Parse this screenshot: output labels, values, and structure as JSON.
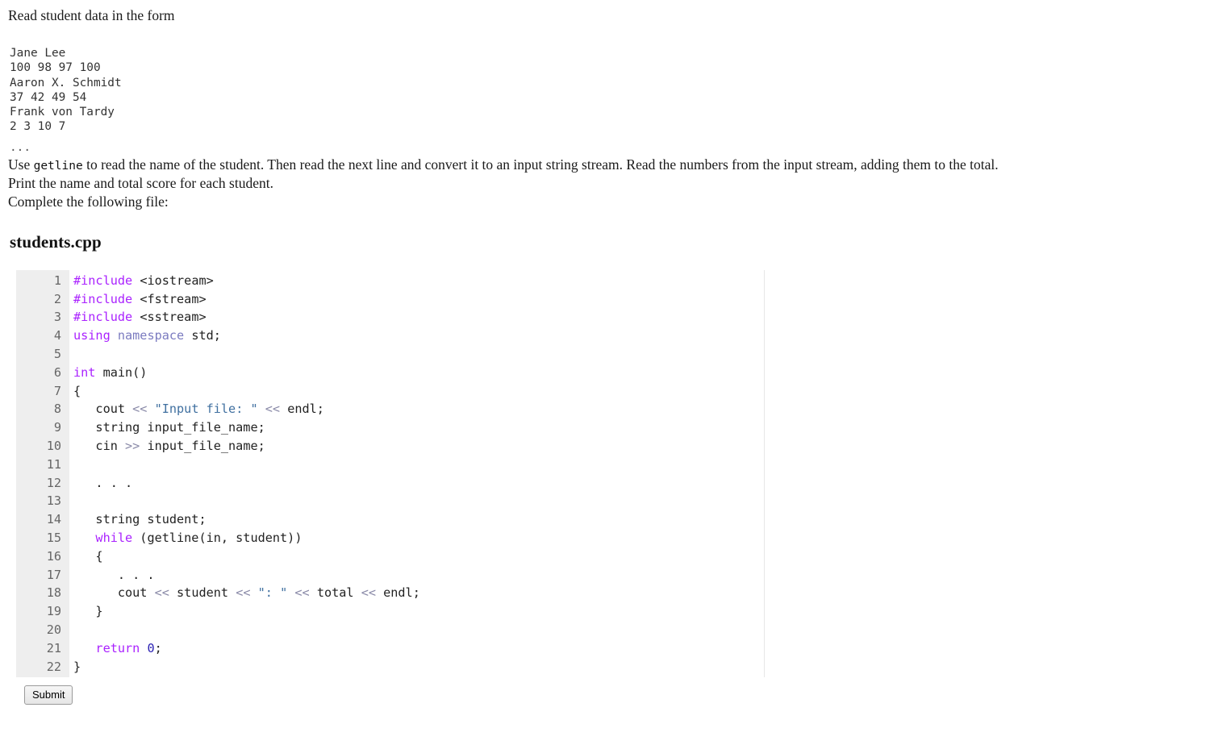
{
  "intro": {
    "text": "Read student data in the form"
  },
  "sample_data": {
    "lines": [
      "Jane Lee",
      "100 98 97 100",
      "Aaron X. Schmidt",
      "37 42 49 54",
      "Frank von Tardy",
      "2 3 10 7"
    ],
    "ellipsis": "..."
  },
  "instructions": {
    "getline_before": "Use ",
    "getline_code": "getline",
    "getline_after": " to read the name of the student. Then read the next line and convert it to an input string stream. Read the numbers from the input stream, adding them to the total.",
    "print": "Print the name and total score for each student.",
    "complete": "Complete the following file:"
  },
  "file": {
    "name": "students.cpp"
  },
  "editor": {
    "line_numbers": [
      "1",
      "2",
      "3",
      "4",
      "5",
      "6",
      "7",
      "8",
      "9",
      "10",
      "11",
      "12",
      "13",
      "14",
      "15",
      "16",
      "17",
      "18",
      "19",
      "20",
      "21",
      "22"
    ],
    "lines": [
      "#include <iostream>",
      "#include <fstream>",
      "#include <sstream>",
      "using namespace std;",
      "",
      "int main()",
      "{",
      "   cout << \"Input file: \" << endl;",
      "   string input_file_name;",
      "   cin >> input_file_name;",
      "",
      "   . . .",
      "",
      "   string student;",
      "   while (getline(in, student))",
      "   {",
      "      . . .",
      "      cout << student << \": \" << total << endl;",
      "   }",
      "",
      "   return 0;",
      "}"
    ]
  },
  "actions": {
    "submit_label": "Submit"
  },
  "colors": {
    "gutter_background": "#eeeeee",
    "gutter_text": "#666666",
    "keyword": "#aa22ff",
    "namespace": "#7b7bc0",
    "string": "#4070a0",
    "operator": "#8a8aa8",
    "number": "#2b21b3",
    "code_text": "#222222",
    "page_background": "#ffffff",
    "body_text": "#1a1a1a"
  }
}
